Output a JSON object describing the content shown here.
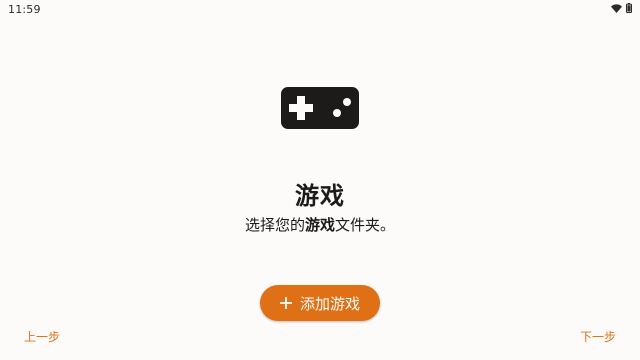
{
  "status_bar": {
    "time": "11:59",
    "icons": [
      "wifi-icon",
      "battery-icon"
    ]
  },
  "main": {
    "icon": "gamepad-icon",
    "title": "游戏",
    "subtitle_prefix": "选择您的",
    "subtitle_bold": "游戏",
    "subtitle_suffix": "文件夹。"
  },
  "actions": {
    "add_button_label": "添加游戏",
    "add_button_icon": "plus-icon"
  },
  "navigation": {
    "prev_label": "上一步",
    "next_label": "下一步"
  },
  "colors": {
    "accent": "#e07016",
    "background": "#fdfbf9",
    "icon": "#1c1b1a"
  }
}
